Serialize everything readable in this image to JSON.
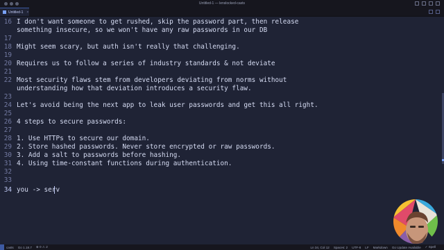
{
  "window": {
    "title": "Untitled-1 — lenslocked-casts"
  },
  "tab": {
    "label": "Untitled-1",
    "close": "×"
  },
  "editor": {
    "lines": [
      {
        "n": "16",
        "text": "I don't want someone to get rushed, skip the password part, then release"
      },
      {
        "n": "",
        "text": "something insecure, so we won't have any raw passwords in our DB"
      },
      {
        "n": "17",
        "text": ""
      },
      {
        "n": "18",
        "text": "Might seem scary, but auth isn't really that challenging."
      },
      {
        "n": "19",
        "text": ""
      },
      {
        "n": "20",
        "text": "Requires us to follow a series of industry standards & not deviate"
      },
      {
        "n": "21",
        "text": ""
      },
      {
        "n": "22",
        "text": "Most security flaws stem from developers deviating from norms without"
      },
      {
        "n": "",
        "text": "understanding how that deviation introduces a security flaw."
      },
      {
        "n": "23",
        "text": ""
      },
      {
        "n": "24",
        "text": "Let's avoid being the next app to leak user passwords and get this all right."
      },
      {
        "n": "25",
        "text": ""
      },
      {
        "n": "26",
        "text": "4 steps to secure passwords:"
      },
      {
        "n": "27",
        "text": ""
      },
      {
        "n": "28",
        "text": "1. Use HTTPs to secure our domain."
      },
      {
        "n": "29",
        "text": "2. Store hashed passwords. Never store encrypted or raw passwords."
      },
      {
        "n": "30",
        "text": "3. Add a salt to passwords before hashing."
      },
      {
        "n": "31",
        "text": "4. Using time-constant functions during authentication."
      },
      {
        "n": "32",
        "text": ""
      },
      {
        "n": "33",
        "text": ""
      },
      {
        "n": "34",
        "text": "you -> serv"
      }
    ]
  },
  "statusbar": {
    "branch": "casts",
    "go_version": "Go 1.18.7",
    "problems": "⊗ 0 ⚠ 2",
    "position": "Ln 34, Col 12",
    "spaces": "Spaces: 2",
    "encoding": "UTF-8",
    "eol": "LF",
    "language": "Markdown",
    "update": "Go Update Available",
    "spell": "✓ Spell"
  },
  "colors": {
    "background": "#1f2335",
    "text": "#d5dbf2",
    "line_numbers": "#737aa2",
    "accent": "#7aa2f7"
  }
}
